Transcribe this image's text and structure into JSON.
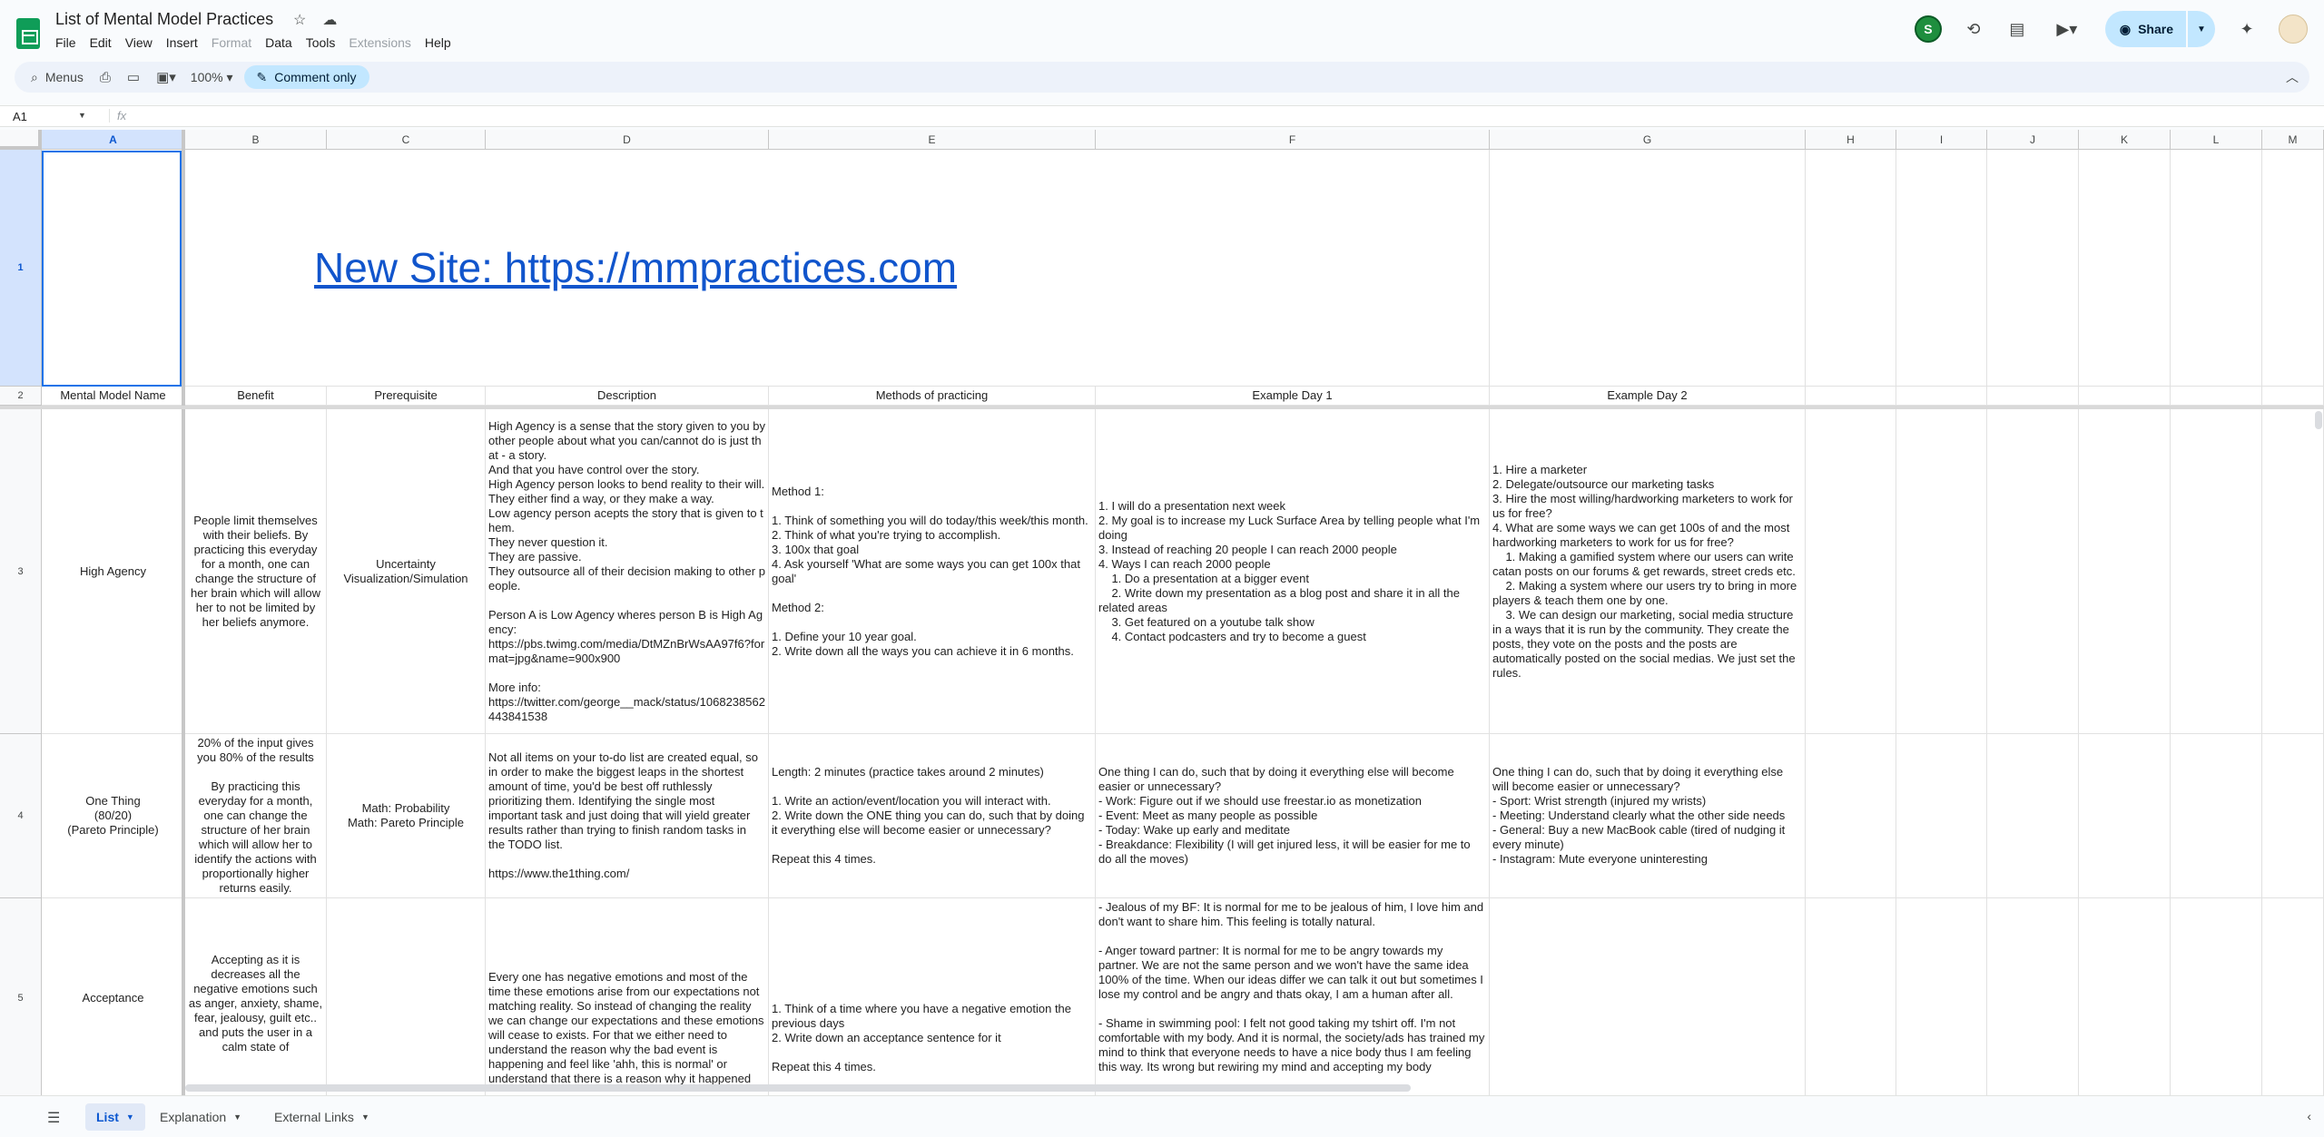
{
  "app": {
    "title": "List of Mental Model Practices",
    "menu": [
      "File",
      "Edit",
      "View",
      "Insert",
      "Format",
      "Data",
      "Tools",
      "Extensions",
      "Help"
    ],
    "disabled_menu": [
      "Format",
      "Extensions"
    ],
    "share_label": "Share",
    "user_initial": "S"
  },
  "toolbar": {
    "menus_label": "Menus",
    "zoom": "100%",
    "comment_only": "Comment only"
  },
  "formula": {
    "namebox": "A1",
    "fx": "fx"
  },
  "columns": [
    "A",
    "B",
    "C",
    "D",
    "E",
    "F",
    "G",
    "H",
    "I",
    "J",
    "K",
    "L",
    "M"
  ],
  "rows": [
    "1",
    "2",
    "3",
    "4",
    "5"
  ],
  "banner": {
    "link_text": "New Site: https://mmpractices.com"
  },
  "headers": {
    "A": "Mental Model Name",
    "B": "Benefit",
    "C": "Prerequisite",
    "D": "Description",
    "E": "Methods of practicing",
    "F": "Example Day 1",
    "G": "Example Day 2"
  },
  "table": [
    {
      "name": "High Agency",
      "benefit": "People limit themselves with their beliefs. By practicing this everyday for a month, one can change the structure of her brain which will allow her to not be limited by her beliefs anymore.",
      "prerequisite": "Uncertainty\nVisualization/Simulation",
      "description": "High Agency is a sense that the story given to you by other people about what you can/cannot do is just that - a story.\nAnd that you have control over the story.\nHigh Agency person looks to bend reality to their will.\nThey either find a way, or they make a way.\nLow agency person acepts the story that is given to them.\nThey never question it.\nThey are passive.\nThey outsource all of their decision making to other people.\n\nPerson A is Low Agency wheres person B is High Agency:\nhttps://pbs.twimg.com/media/DtMZnBrWsAA97f6?format=jpg&name=900x900\n\nMore info:\nhttps://twitter.com/george__mack/status/1068238562443841538",
      "methods": "Method 1:\n\n1. Think of something you will do today/this week/this month.\n2. Think of what you're trying to accomplish.\n3. 100x that goal\n4. Ask yourself 'What are some ways you can get 100x that goal'\n\nMethod 2:\n\n1. Define your 10 year goal.\n2. Write down all the ways you can achieve it in 6 months.",
      "day1": "1. I will do a presentation next week\n2. My goal is to increase my Luck Surface Area by telling people what I'm doing\n3. Instead of reaching 20 people I can reach 2000 people\n4. Ways I can reach 2000 people\n    1. Do a presentation at a bigger event\n    2. Write down my presentation as a blog post and share it in all the related areas\n    3. Get featured on a youtube talk show\n    4. Contact podcasters and try to become a guest",
      "day2": "1. Hire a marketer\n2. Delegate/outsource our marketing tasks\n3. Hire the most willing/hardworking marketers to work for us for free?\n4. What are some ways we can get 100s of and the most hardworking marketers to work for us for free?\n    1. Making a gamified system where our users can write catan posts on our forums & get rewards, street creds etc.\n    2. Making a system where our users try to bring in more players & teach them one by one.\n    3. We can design our marketing, social media structure in a ways that it is run by the community. They create the posts, they vote on the posts and the posts are automatically posted on the social medias. We just set the rules."
    },
    {
      "name": "One Thing\n(80/20)\n(Pareto Principle)",
      "benefit": "20% of the input gives you 80% of the results\n\nBy practicing this everyday for a month, one can change the structure of her brain which will allow her to identify the actions with proportionally higher returns easily.",
      "prerequisite": "Math: Probability\nMath: Pareto Principle",
      "description": "Not all items on your to-do list are created equal, so in order to make the biggest leaps in the shortest amount of time, you'd be best off ruthlessly prioritizing them. Identifying the single most important task and just doing that will yield greater results rather than trying to finish random tasks in the TODO list.\n\nhttps://www.the1thing.com/",
      "methods": "Length: 2 minutes (practice takes around 2 minutes)\n\n1. Write an action/event/location you will interact with.\n2. Write down the ONE thing you can do, such that by doing it everything else will become easier or unnecessary?\n\nRepeat this 4 times.",
      "day1": "One thing I can do, such that by doing it everything else will become easier or unnecessary?\n- Work: Figure out if we should use freestar.io as monetization\n- Event: Meet as many people as possible\n- Today: Wake up early and meditate\n- Breakdance: Flexibility (I will get injured less, it will be easier for me to do all the moves)",
      "day2": "One thing I can do, such that by doing it everything else will become easier or unnecessary?\n- Sport: Wrist strength (injured my wrists)\n- Meeting: Understand clearly what the other side needs\n- General: Buy a new MacBook cable (tired of nudging it every minute)\n- Instagram: Mute everyone uninteresting"
    },
    {
      "name": "Acceptance",
      "benefit": "Accepting as it is decreases all the negative emotions such as anger, anxiety, shame, fear, jealousy, guilt etc.. and puts the user in a calm state of",
      "prerequisite": "",
      "description": "Every one has negative emotions and most of the time these emotions arise from our expectations not matching reality. So instead of changing the reality we can change our expectations and these emotions will cease to exists. For that we either need to understand the reason why the bad event is happening and feel like 'ahh, this is normal' or understand that there is a reason why it happened",
      "methods": "1. Think of a time where you have a negative emotion the previous days\n2. Write down an acceptance sentence for it\n\nRepeat this 4 times.",
      "day1": "- Jealous of my BF: It is normal for me to be jealous of him, I love him and don't want to share him. This feeling is totally natural.\n\n- Anger toward partner: It is normal for me to be angry towards my partner. We are not the same person and we won't have the same idea 100% of the time. When our ideas differ we can talk it out but sometimes I lose my control and be angry and thats okay, I am a human after all.\n\n- Shame in swimming pool: I felt not good taking my tshirt off. I'm not comfortable with my body. And it is normal, the society/ads has trained my mind to think that everyone needs to have a nice body thus I am feeling this way. Its wrong but rewiring my mind and accepting my body",
      "day2": ""
    }
  ],
  "sheets": {
    "tabs": [
      "List",
      "Explanation",
      "External Links"
    ],
    "active": "List"
  }
}
